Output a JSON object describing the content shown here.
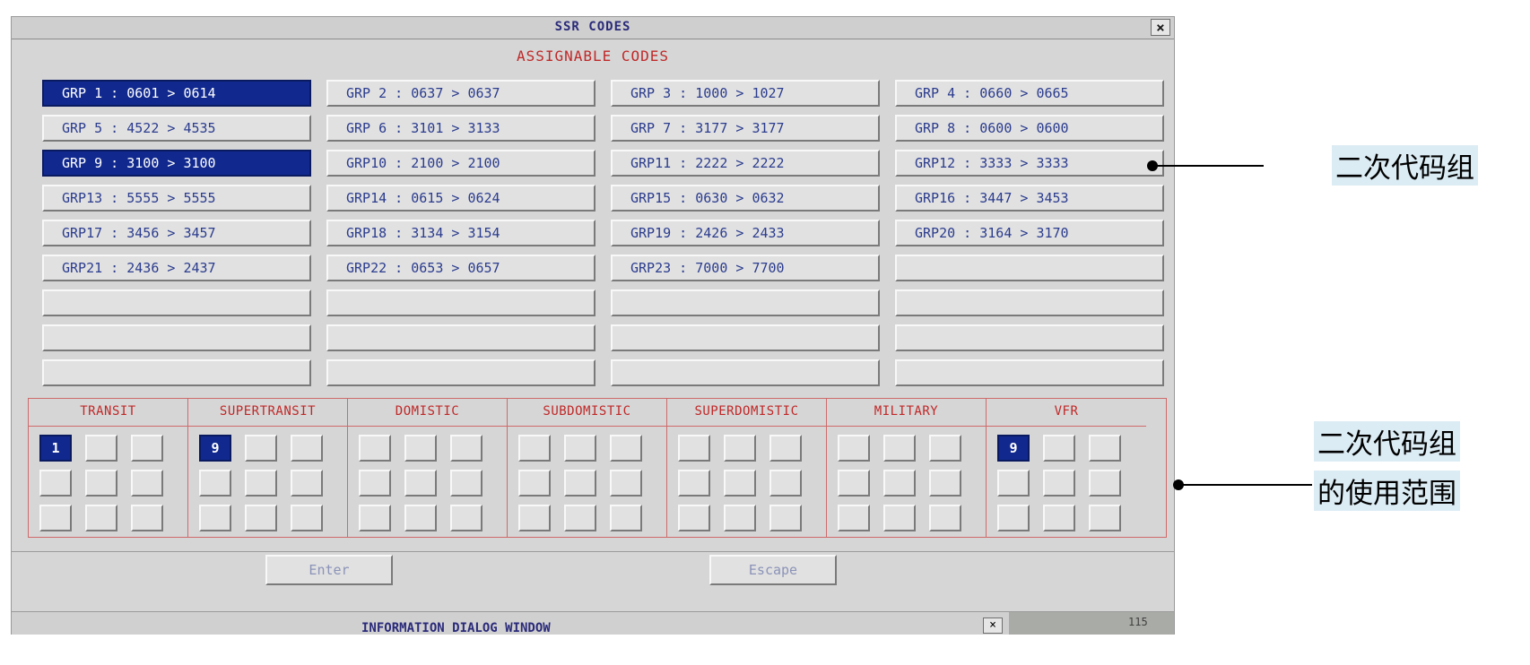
{
  "dialog": {
    "title": "SSR CODES",
    "close_label": "×",
    "section_title": "ASSIGNABLE CODES"
  },
  "groups": [
    {
      "label": "GRP 1 : 0601 > 0614",
      "selected": true
    },
    {
      "label": "GRP 2 : 0637 > 0637",
      "selected": false
    },
    {
      "label": "GRP 3 : 1000 > 1027",
      "selected": false
    },
    {
      "label": "GRP 4 : 0660 > 0665",
      "selected": false
    },
    {
      "label": "GRP 5 : 4522 > 4535",
      "selected": false
    },
    {
      "label": "GRP 6 : 3101 > 3133",
      "selected": false
    },
    {
      "label": "GRP 7 : 3177 > 3177",
      "selected": false
    },
    {
      "label": "GRP 8 : 0600 > 0600",
      "selected": false
    },
    {
      "label": "GRP 9 : 3100 > 3100",
      "selected": true
    },
    {
      "label": "GRP10 : 2100 > 2100",
      "selected": false
    },
    {
      "label": "GRP11 : 2222 > 2222",
      "selected": false
    },
    {
      "label": "GRP12 : 3333 > 3333",
      "selected": false
    },
    {
      "label": "GRP13 : 5555 > 5555",
      "selected": false
    },
    {
      "label": "GRP14 : 0615 > 0624",
      "selected": false
    },
    {
      "label": "GRP15 : 0630 > 0632",
      "selected": false
    },
    {
      "label": "GRP16 : 3447 > 3453",
      "selected": false
    },
    {
      "label": "GRP17 : 3456 > 3457",
      "selected": false
    },
    {
      "label": "GRP18 : 3134 > 3154",
      "selected": false
    },
    {
      "label": "GRP19 : 2426 > 2433",
      "selected": false
    },
    {
      "label": "GRP20 : 3164 > 3170",
      "selected": false
    },
    {
      "label": "GRP21 : 2436 > 2437",
      "selected": false
    },
    {
      "label": "GRP22 : 0653 > 0657",
      "selected": false
    },
    {
      "label": "GRP23 : 7000 > 7700",
      "selected": false
    },
    {
      "label": "",
      "selected": false
    },
    {
      "label": "",
      "selected": false
    },
    {
      "label": "",
      "selected": false
    },
    {
      "label": "",
      "selected": false
    },
    {
      "label": "",
      "selected": false
    },
    {
      "label": "",
      "selected": false
    },
    {
      "label": "",
      "selected": false
    },
    {
      "label": "",
      "selected": false
    },
    {
      "label": "",
      "selected": false
    },
    {
      "label": "",
      "selected": false
    },
    {
      "label": "",
      "selected": false
    },
    {
      "label": "",
      "selected": false
    },
    {
      "label": "",
      "selected": false
    }
  ],
  "categories": [
    {
      "name": "TRANSIT",
      "cells": [
        "1",
        "",
        "",
        "",
        "",
        "",
        "",
        "",
        ""
      ],
      "selected_index": 0
    },
    {
      "name": "SUPERTRANSIT",
      "cells": [
        "9",
        "",
        "",
        "",
        "",
        "",
        "",
        "",
        ""
      ],
      "selected_index": 0
    },
    {
      "name": "DOMISTIC",
      "cells": [
        "",
        "",
        "",
        "",
        "",
        "",
        "",
        "",
        ""
      ],
      "selected_index": -1
    },
    {
      "name": "SUBDOMISTIC",
      "cells": [
        "",
        "",
        "",
        "",
        "",
        "",
        "",
        "",
        ""
      ],
      "selected_index": -1
    },
    {
      "name": "SUPERDOMISTIC",
      "cells": [
        "",
        "",
        "",
        "",
        "",
        "",
        "",
        "",
        ""
      ],
      "selected_index": -1
    },
    {
      "name": "MILITARY",
      "cells": [
        "",
        "",
        "",
        "",
        "",
        "",
        "",
        "",
        ""
      ],
      "selected_index": -1
    },
    {
      "name": "VFR",
      "cells": [
        "9",
        "",
        "",
        "",
        "",
        "",
        "",
        "",
        ""
      ],
      "selected_index": 0
    }
  ],
  "buttons": {
    "enter": "Enter",
    "escape": "Escape"
  },
  "info_bar": {
    "title": "INFORMATION DIALOG WINDOW",
    "close_label": "×",
    "value": "115"
  },
  "annotations": {
    "group_label": "二次代码组",
    "usage_label_line1": "二次代码组",
    "usage_label_line2": "的使用范围"
  },
  "colors": {
    "selected_bg": "#11298e",
    "category_red": "#c02828",
    "button_text": "#2b3c8e"
  }
}
